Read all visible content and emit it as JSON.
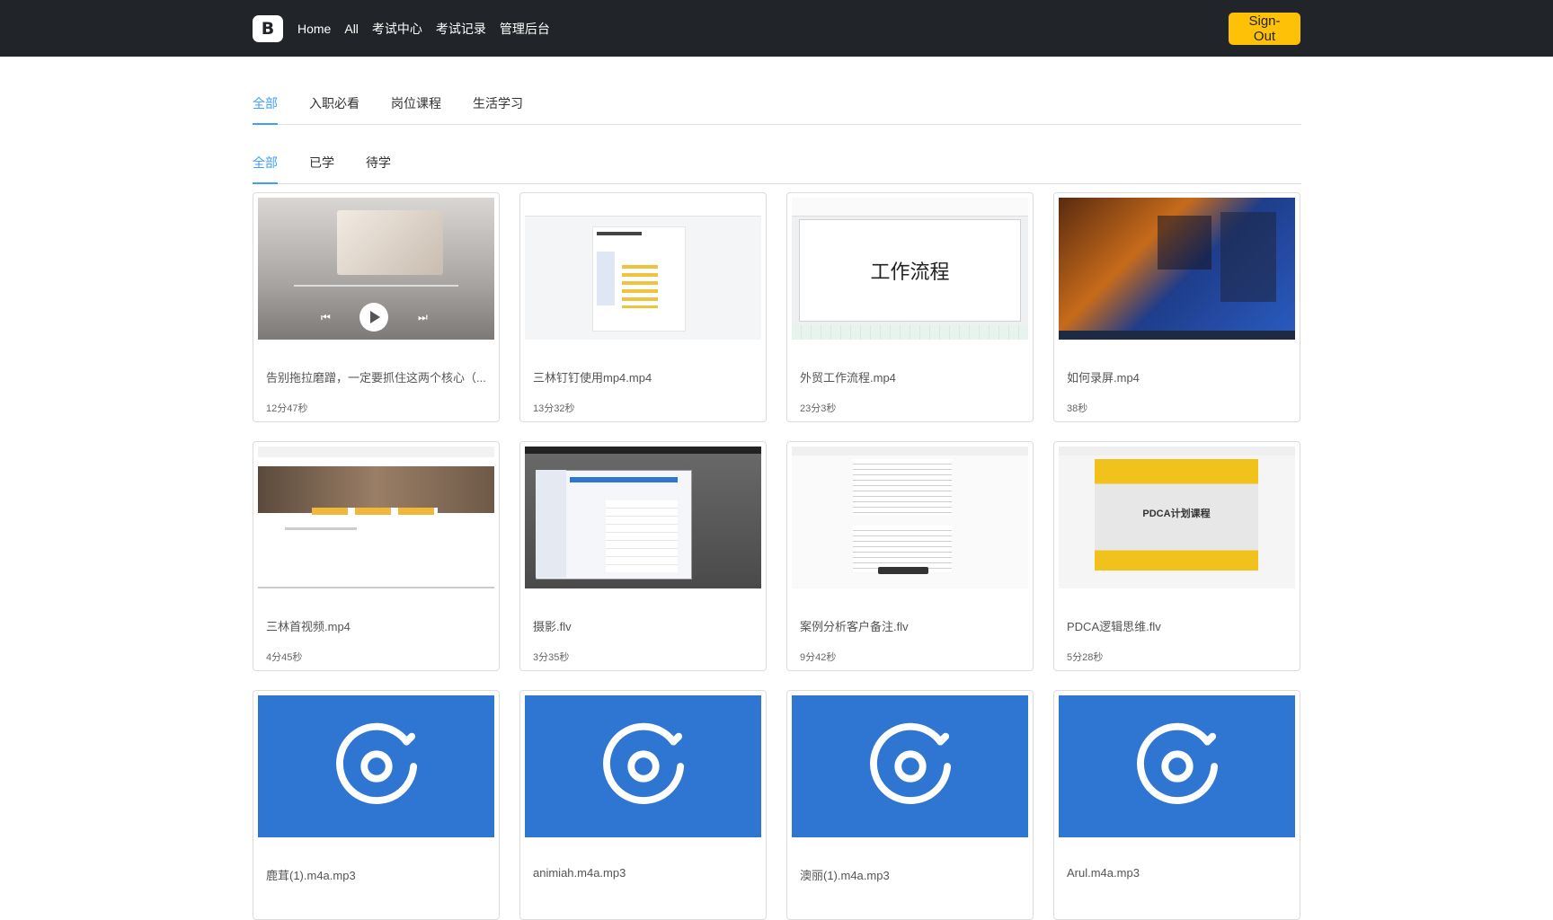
{
  "navbar": {
    "brand": "B",
    "links": [
      "Home",
      "All",
      "考试中心",
      "考试记录",
      "管理后台"
    ],
    "signout_label": "Sign-Out"
  },
  "category_tabs": [
    "全部",
    "入职必看",
    "岗位课程",
    "生活学习"
  ],
  "status_tabs": [
    "全部",
    "已学",
    "待学"
  ],
  "ppt_title": "工作流程",
  "pdca_title": "PDCA计划课程",
  "cards": [
    {
      "title": "告别拖拉磨蹭，一定要抓住这两个核心（...",
      "duration": "12分47秒",
      "thumb": "photo"
    },
    {
      "title": "三林钉钉使用mp4.mp4",
      "duration": "13分32秒",
      "thumb": "doc"
    },
    {
      "title": "外贸工作流程.mp4",
      "duration": "23分3秒",
      "thumb": "ppt"
    },
    {
      "title": "如何录屏.mp4",
      "duration": "38秒",
      "thumb": "space"
    },
    {
      "title": "三林首视频.mp4",
      "duration": "4分45秒",
      "thumb": "site"
    },
    {
      "title": "摄影.flv",
      "duration": "3分35秒",
      "thumb": "desk"
    },
    {
      "title": "案例分析客户备注.flv",
      "duration": "9分42秒",
      "thumb": "notes"
    },
    {
      "title": "PDCA逻辑思维.flv",
      "duration": "5分28秒",
      "thumb": "pdca"
    },
    {
      "title": "鹿茸(1).m4a.mp3",
      "duration": "",
      "thumb": "audio"
    },
    {
      "title": "animiah.m4a.mp3",
      "duration": "",
      "thumb": "audio"
    },
    {
      "title": "澳丽(1).m4a.mp3",
      "duration": "",
      "thumb": "audio"
    },
    {
      "title": "Arul.m4a.mp3",
      "duration": "",
      "thumb": "audio"
    }
  ],
  "colors": {
    "navbar": "#212529",
    "accent": "#409eff",
    "signout": "#ffc107",
    "audio_bg": "#2f76d2"
  }
}
